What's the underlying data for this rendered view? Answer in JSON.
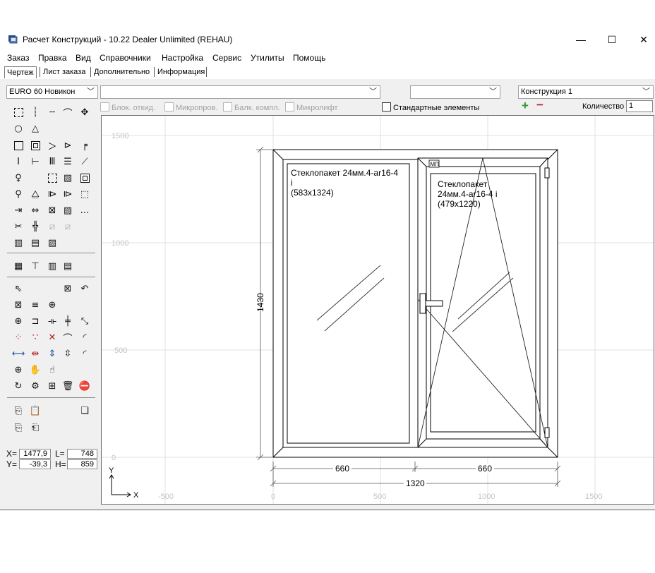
{
  "window": {
    "title": "Расчет Конструкций - 10.22 Dealer Unlimited (REHAU)",
    "minimize": "—",
    "maximize": "☐",
    "close": "✕"
  },
  "menu": {
    "items": [
      "Заказ",
      "Правка",
      "Вид",
      "Справочники",
      "Настройка",
      "Сервис",
      "Утилиты",
      "Помощь"
    ]
  },
  "tabs": [
    {
      "label": "Чертеж",
      "active": true
    },
    {
      "label": "Лист заказа",
      "active": false
    },
    {
      "label": "Дополнительно",
      "active": false
    },
    {
      "label": "Информация",
      "active": false
    }
  ],
  "toolbar": {
    "profile_select": "EURO 60 Новикон",
    "combo_2": "",
    "combo_3": "",
    "construction_select": "Конструкция 1",
    "options": {
      "blok_otkid": "Блок. откид.",
      "mikroprov": "Микропров.",
      "balk_kompl": "Балк. компл.",
      "mikrolift": "Микролифт",
      "standard_elements": "Стандартные элементы"
    },
    "plus": "+",
    "minus": "−",
    "quantity_label": "Количество",
    "quantity_value": "1"
  },
  "coords": {
    "x_label": "X=",
    "x_value": "1477,9",
    "y_label": "Y=",
    "y_value": "-39,3",
    "l_label": "L=",
    "l_value": "748",
    "h_label": "H=",
    "h_value": "859"
  },
  "drawing": {
    "y_ticks": [
      "1500",
      "1000",
      "500",
      "0"
    ],
    "x_ticks": [
      "-500",
      "0",
      "500",
      "1000",
      "1500"
    ],
    "axis_y": "Y",
    "axis_x": "X",
    "height_dim": "1430",
    "width_dim_left": "660",
    "width_dim_right": "660",
    "width_dim_total": "1320",
    "mp_badge": "МП",
    "left_glass": {
      "line1": "Стеклопакет 24мм.4-ar16-4",
      "line2": "i",
      "line3": "(583x1324)"
    },
    "right_glass": {
      "line1": "Стеклопакет",
      "line2": "24мм.4-ar16-4 i",
      "line3": "(479x1220)"
    }
  },
  "colors": {
    "grid": "#e2e2e2",
    "frame": "#000000",
    "plus": "#2f9a2f",
    "minus": "#c0273a",
    "panel": "#f0f0f0"
  }
}
